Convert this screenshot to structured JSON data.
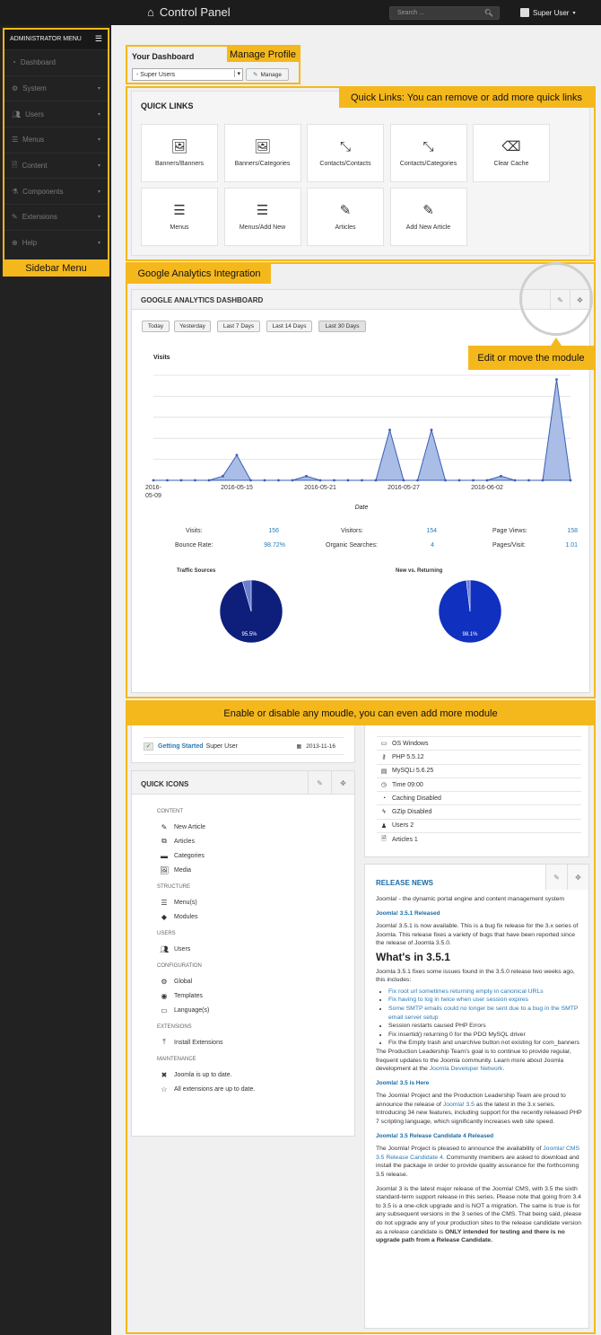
{
  "header": {
    "title": "Control Panel",
    "search_placeholder": "Search ...",
    "user": "Super User"
  },
  "sidebar": {
    "heading": "ADMINISTRATOR MENU",
    "items": [
      {
        "label": "Dashboard",
        "icon": "dashboard-icon"
      },
      {
        "label": "System",
        "icon": "gear-icon"
      },
      {
        "label": "Users",
        "icon": "users-icon"
      },
      {
        "label": "Menus",
        "icon": "menu-icon"
      },
      {
        "label": "Content",
        "icon": "file-icon"
      },
      {
        "label": "Components",
        "icon": "cubes-icon"
      },
      {
        "label": "Extensions",
        "icon": "puzzle-icon"
      },
      {
        "label": "Help",
        "icon": "help-icon"
      }
    ],
    "annotation": "Sidebar Menu"
  },
  "dashboard": {
    "title": "Your Dashboard",
    "select_value": "- Super Users",
    "manage_label": "Manage",
    "annotation": "Manage Profile"
  },
  "quick_links": {
    "title": "QUICK LINKS",
    "annotation": "Quick Links: You can remove or add more quick links",
    "items": [
      {
        "label": "Banners/Banners",
        "icon": "image-icon"
      },
      {
        "label": "Banners/Categories",
        "icon": "image-icon"
      },
      {
        "label": "Contacts/Contacts",
        "icon": "compress-icon"
      },
      {
        "label": "Contacts/Categories",
        "icon": "compress-icon"
      },
      {
        "label": "Clear Cache",
        "icon": "eraser-icon"
      },
      {
        "label": "Menus",
        "icon": "list-icon"
      },
      {
        "label": "Menus/Add New",
        "icon": "list-icon"
      },
      {
        "label": "Articles",
        "icon": "pencil-icon"
      },
      {
        "label": "Add New Article",
        "icon": "pencil-icon"
      }
    ]
  },
  "analytics": {
    "annotation": "Google Analytics Integration",
    "title": "GOOGLE ANALYTICS DASHBOARD",
    "edit_annotation": "Edit or move the module",
    "ranges": [
      "Today",
      "Yesterday",
      "Last 7 Days",
      "Last 14 Days",
      "Last 30 Days"
    ],
    "stats": {
      "visits_label": "Visits:",
      "visits": "156",
      "visitors_label": "Visitors:",
      "visitors": "154",
      "pageviews_label": "Page Views:",
      "pageviews": "158",
      "bounce_label": "Bounce Rate:",
      "bounce": "98.72%",
      "organic_label": "Organic Searches:",
      "organic": "4",
      "ppv_label": "Pages/Visit:",
      "ppv": "1.01"
    },
    "pie1_title": "Traffic Sources",
    "pie1_value": "95.5%",
    "pie2_title": "New vs. Returning",
    "pie2_value": "98.1%",
    "colors": {
      "pie1": "#0d1f7a",
      "pie2": "#1030c0",
      "line": "#3a5fb5",
      "fill": "#a9bde6"
    }
  },
  "chart_data": {
    "type": "area",
    "title": "Visits",
    "xlabel": "Date",
    "ylabel": "",
    "x_ticks": [
      "2016-05-09",
      "2016-05-15",
      "2016-05-21",
      "2016-05-27",
      "2016-06-02"
    ],
    "series": [
      {
        "name": "Visits",
        "values": [
          0,
          0,
          0,
          0,
          0,
          1,
          6,
          0,
          0,
          0,
          0,
          1,
          0,
          0,
          0,
          0,
          0,
          12,
          0,
          0,
          12,
          0,
          0,
          0,
          0,
          1,
          0,
          0,
          0,
          24,
          0
        ]
      }
    ],
    "ylim": [
      0,
      25
    ],
    "grid": true
  },
  "modules": {
    "annotation": "Enable or disable any moudle, you can even add more module",
    "getting_started": "Getting Started",
    "getting_started_user": "Super User",
    "getting_started_date": "2013-11-16",
    "quick_icons_title": "QUICK ICONS",
    "sections": [
      {
        "title": "CONTENT",
        "items": [
          {
            "label": "New Article",
            "icon": "pencil-icon"
          },
          {
            "label": "Articles",
            "icon": "copy-icon"
          },
          {
            "label": "Categories",
            "icon": "folder-icon"
          },
          {
            "label": "Media",
            "icon": "image-icon"
          }
        ]
      },
      {
        "title": "STRUCTURE",
        "items": [
          {
            "label": "Menu(s)",
            "icon": "list-icon"
          },
          {
            "label": "Modules",
            "icon": "cube-icon"
          }
        ]
      },
      {
        "title": "USERS",
        "items": [
          {
            "label": "Users",
            "icon": "users-icon"
          }
        ]
      },
      {
        "title": "CONFIGURATION",
        "items": [
          {
            "label": "Global",
            "icon": "gear-icon"
          },
          {
            "label": "Templates",
            "icon": "eye-icon"
          },
          {
            "label": "Language(s)",
            "icon": "comments-icon"
          }
        ]
      },
      {
        "title": "EXTENSIONS",
        "items": [
          {
            "label": "Install Extensions",
            "icon": "upload-icon"
          }
        ]
      },
      {
        "title": "MAINTENANCE",
        "items": [
          {
            "label": "Joomla is up to date.",
            "icon": "joomla-icon"
          },
          {
            "label": "All extensions are up to date.",
            "icon": "star-icon"
          }
        ]
      }
    ],
    "system": [
      {
        "label": "OS Windows",
        "icon": "monitor-icon"
      },
      {
        "label": "PHP 5.5.12",
        "icon": "key-icon"
      },
      {
        "label": "MySQLi 5.6.25",
        "icon": "database-icon"
      },
      {
        "label": "Time 09:00",
        "icon": "clock-icon"
      },
      {
        "label": "Caching Disabled",
        "icon": "dashboard-icon"
      },
      {
        "label": "GZip Disabled",
        "icon": "bolt-icon"
      },
      {
        "label": "Users 2",
        "icon": "user-icon"
      },
      {
        "label": "Articles 1",
        "icon": "file-icon"
      }
    ],
    "release_news": {
      "title": "RELEASE NEWS",
      "intro": "Joomla! - the dynamic portal engine and content management system",
      "h1": "Joomla! 3.5.1 Released",
      "p1": "Joomla! 3.5.1 is now available. This is a bug fix release for the 3.x series of Joomla. This release fixes a variety of bugs that have been reported since the release of Joomla 3.5.0.",
      "big": "What's in 3.5.1",
      "p2": "Joomla 3.5.1 fixes some issues found in the 3.5.0 release two weeks ago, this includes:",
      "bullets_links": [
        "Fix root url sometimes returning empty in canonical URLs",
        "Fix having to log in twice when user session expires",
        "Some SMTP emails could no longer be sent due to a bug in the SMTP email server setup"
      ],
      "bullets_plain": [
        "Session restarts caused PHP Errors",
        "Fix insertid() returning 0 for the PDO MySQL driver",
        "Fix the Empty trash and unarchive button not existing for com_banners"
      ],
      "p3_a": "The Production Leadership Team's goal is to continue to provide regular, frequent updates to the Joomla community. Learn more about Joomla development at the ",
      "p3_link": "Joomla Developer Network",
      "p3_b": ".",
      "h2": "Joomla! 3.5 is Here",
      "p4_a": "The Joomla! Project and the Production Leadership Team are proud to announce the release of ",
      "p4_link": "Joomla! 3.5",
      "p4_b": " as the latest in the 3.x series. Introducing 34 new features, including support for the recently released PHP 7 scripting language, which significantly increases web site speed.",
      "h3": "Joomla! 3.5 Release Candidate 4 Released",
      "p5_a": "The Joomla! Project is pleased to announce the availability of ",
      "p5_link": "Joomla! CMS 3.5 Release Candidate 4",
      "p5_b": ". Community members are asked to download and install the package in order to provide quality assurance for the forthcoming 3.5 release.",
      "p6_a": "Joomla! 3 is the latest major release of the Joomla! CMS, with 3.5 the sixth standard-term support release in this series. Please note that going from 3.4 to 3.5 is a one-click upgrade and is NOT a migration. The same is true is for any subsequent versions in the 3 series of the CMS. That being said, please do not upgrade any of your production sites to the release candidate version as a release candidate is ",
      "p6_strong": "ONLY intended for testing and there is no upgrade path from a Release Candidate."
    }
  }
}
